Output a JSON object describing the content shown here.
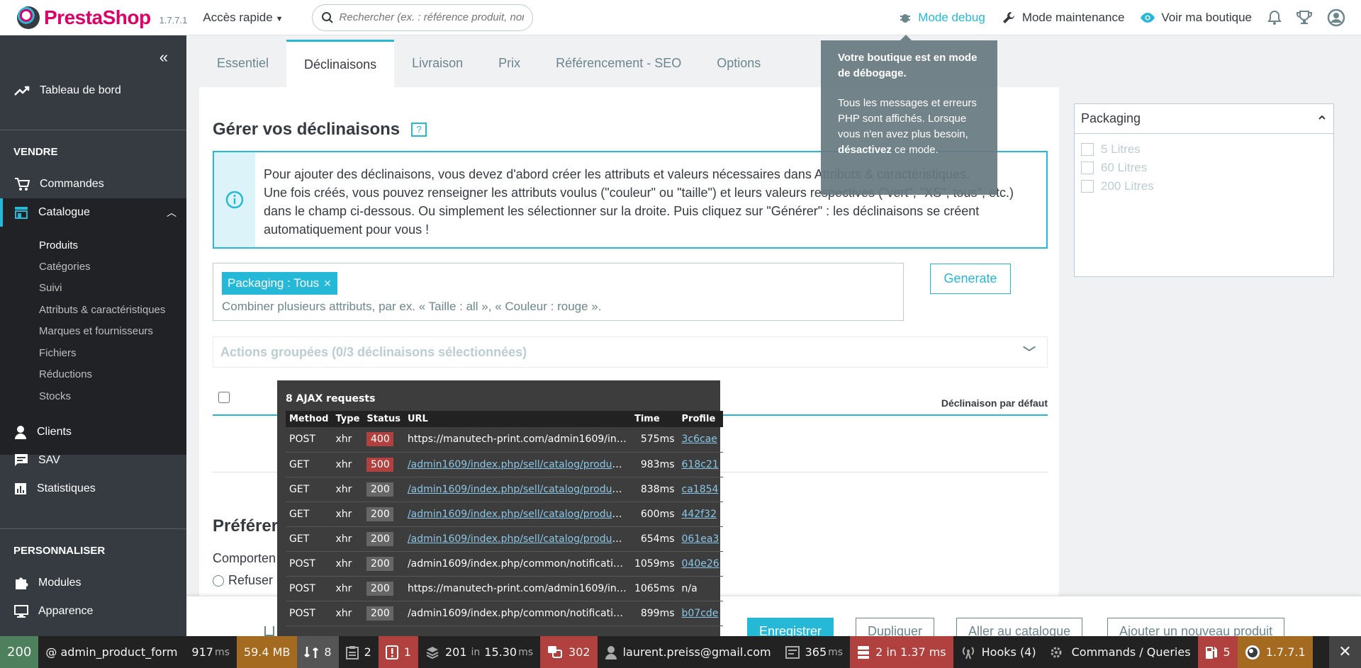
{
  "header": {
    "logo_text": "PrestaShop",
    "version": "1.7.7.1",
    "quick_access": "Accès rapide",
    "search_placeholder": "Rechercher (ex. : référence produit, nom",
    "debug_mode": "Mode debug",
    "maintenance_mode": "Mode maintenance",
    "view_shop": "Voir ma boutique"
  },
  "sidebar": {
    "dashboard": "Tableau de bord",
    "section_sell": "VENDRE",
    "orders": "Commandes",
    "catalog": "Catalogue",
    "catalog_sub": [
      "Produits",
      "Catégories",
      "Suivi",
      "Attributs & caractéristiques",
      "Marques et fournisseurs",
      "Fichiers",
      "Réductions",
      "Stocks"
    ],
    "customers": "Clients",
    "service": "SAV",
    "stats": "Statistiques",
    "section_custom": "PERSONNALISER",
    "modules": "Modules",
    "appearance": "Apparence"
  },
  "tabs": [
    "Essentiel",
    "Déclinaisons",
    "Livraison",
    "Prix",
    "Référencement - SEO",
    "Options"
  ],
  "main": {
    "title": "Gérer vos déclinaisons",
    "help": "?",
    "info_line1": "Pour ajouter des déclinaisons, vous devez d'abord créer les attributs et valeurs nécessaires dans Attributs & caractéristiques.",
    "info_line2": "Une fois créés, vous pouvez renseigner les attributs voulus (\"couleur\" ou \"taille\") et leurs valeurs respectives (\"vert\", \"XS\", tous\", etc.)",
    "info_line3": "dans le champ ci-dessous. Ou simplement les sélectionner sur la droite. Puis cliquez sur \"Générer\" : les déclinaisons se créent",
    "info_line4": "automatiquement pour vous !",
    "tag": "Packaging : Tous",
    "tag_placeholder": "Combiner plusieurs attributs, par ex. « Taille : all », « Couleur : rouge ».",
    "generate": "Generate",
    "bulk_actions": "Actions groupées (0/3 déclinaisons sélectionnées)",
    "default_col": "Déclinaison par défaut",
    "pref_title": "Préférer",
    "pref_sub": "Comporten",
    "pref_radio": "Refuser l"
  },
  "packaging": {
    "title": "Packaging",
    "options": [
      "5 Litres",
      "60 Litres",
      "200 Litres"
    ]
  },
  "tooltip": {
    "bold_line": "Votre boutique est en mode de débogage.",
    "text1": "Tous les messages et erreurs PHP sont affichés. Lorsque vous n'en avez plus besoin, ",
    "text_bold": "désactivez",
    "text2": " ce mode."
  },
  "actionbar": {
    "save": "Enregistrer",
    "duplicate": "Dupliquer",
    "catalog": "Aller au catalogue",
    "new_product": "Ajouter un nouveau produit"
  },
  "ajax": {
    "title": "8 AJAX requests",
    "columns": [
      "Method",
      "Type",
      "Status",
      "URL",
      "Time",
      "Profile"
    ],
    "rows": [
      {
        "method": "POST",
        "type": "xhr",
        "status": "400",
        "url": "https://manutech-print.com/admin1609/index...",
        "time": "575ms",
        "profile": "3c6cae"
      },
      {
        "method": "GET",
        "type": "xhr",
        "status": "500",
        "url": "/admin1609/index.php/sell/catalog/products/...",
        "time": "983ms",
        "profile": "618c21"
      },
      {
        "method": "GET",
        "type": "xhr",
        "status": "200",
        "url": "/admin1609/index.php/sell/catalog/products/...",
        "time": "838ms",
        "profile": "ca1854"
      },
      {
        "method": "GET",
        "type": "xhr",
        "status": "200",
        "url": "/admin1609/index.php/sell/catalog/products/...",
        "time": "600ms",
        "profile": "442f32"
      },
      {
        "method": "GET",
        "type": "xhr",
        "status": "200",
        "url": "/admin1609/index.php/sell/catalog/products/...",
        "time": "654ms",
        "profile": "061ea3"
      },
      {
        "method": "POST",
        "type": "xhr",
        "status": "200",
        "url": "/admin1609/index.php/common/notifications...",
        "time": "1059ms",
        "profile": "040e26"
      },
      {
        "method": "POST",
        "type": "xhr",
        "status": "200",
        "url": "https://manutech-print.com/admin1609/index...",
        "time": "1065ms",
        "profile": "n/a"
      },
      {
        "method": "POST",
        "type": "xhr",
        "status": "200",
        "url": "/admin1609/index.php/common/notifications...",
        "time": "899ms",
        "profile": "b07cde"
      }
    ]
  },
  "sfbar": {
    "status": "200",
    "route": "@ admin_product_form",
    "time": "917",
    "time_unit": "ms",
    "memory": "59.4 MB",
    "ajax": "8",
    "forms": "2",
    "errors": "1",
    "cache": "201",
    "cache_in": "in",
    "cache_time": "15.30",
    "cache_unit": "ms",
    "translations": "302",
    "user": "laurent.preiss@gmail.com",
    "db_time": "365",
    "db_unit": "ms",
    "queries": "2 in 1.37 ms",
    "hooks": "Hooks (4)",
    "commands": "Commands / Queries",
    "deprecations": "5",
    "ps_version": "1.7.7.1"
  }
}
